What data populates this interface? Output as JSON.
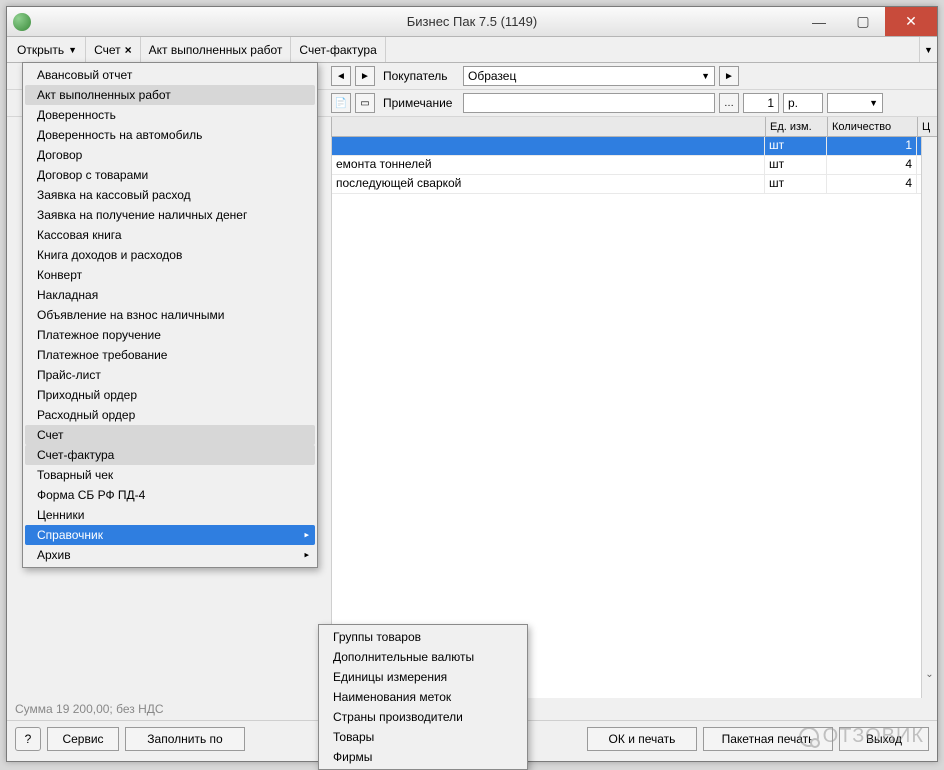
{
  "window": {
    "title": "Бизнес Пак 7.5 (1149)"
  },
  "toolbar": {
    "open": "Открыть",
    "account": "Счет",
    "act": "Акт выполненных работ",
    "invoice": "Счет-фактура"
  },
  "form": {
    "buyer_label": "Покупатель",
    "buyer_value": "Образец",
    "note_label": "Примечание",
    "note_value": "",
    "qty_value": "1",
    "unit_value": "p."
  },
  "table": {
    "headers": {
      "name": "",
      "unit": "Ед. изм.",
      "qty": "Количество",
      "price": "Ц"
    },
    "rows": [
      {
        "name": "",
        "unit": "шт",
        "qty": "1"
      },
      {
        "name": "емонта тоннелей",
        "unit": "шт",
        "qty": "4"
      },
      {
        "name": "последующей сваркой",
        "unit": "шт",
        "qty": "4"
      }
    ]
  },
  "status": "Сумма 19 200,00; без НДС",
  "buttons": {
    "help": "?",
    "service": "Сервис",
    "fill": "Заполнить по",
    "ok_print": "ОК и печать",
    "batch_print": "Пакетная печать",
    "exit": "Выход"
  },
  "menu_main": [
    "Авансовый отчет",
    "Акт выполненных работ",
    "Доверенность",
    "Доверенность на автомобиль",
    "Договор",
    "Договор с товарами",
    "Заявка на кассовый расход",
    "Заявка на получение наличных денег",
    "Кассовая книга",
    "Книга доходов и расходов",
    "Конверт",
    "Накладная",
    "Объявление на взнос наличными",
    "Платежное поручение",
    "Платежное требование",
    "Прайс-лист",
    "Приходный ордер",
    "Расходный ордер",
    "Счет",
    "Счет-фактура",
    "Товарный чек",
    "Форма СБ РФ ПД-4",
    "Ценники",
    "Справочник",
    "Архив"
  ],
  "menu_main_highlight": [
    1,
    18,
    19
  ],
  "menu_main_selected": 23,
  "menu_main_submenu": [
    23,
    24
  ],
  "menu_sub": [
    "Группы товаров",
    "Дополнительные валюты",
    "Единицы измерения",
    "Наименования меток",
    "Страны производители",
    "Товары",
    "Фирмы"
  ],
  "watermark": "ОТЗОВИК"
}
